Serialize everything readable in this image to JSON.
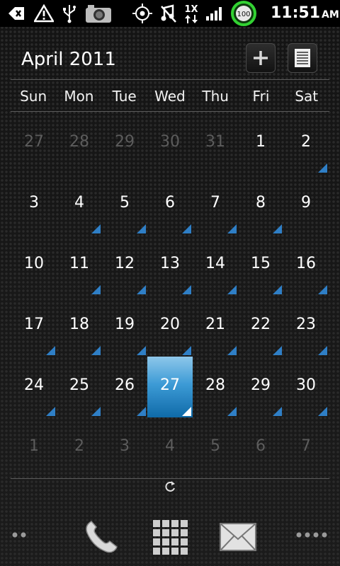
{
  "status_bar": {
    "time": "11:51",
    "ampm": "AM",
    "battery_level": "100",
    "network_label": "1X",
    "icons": [
      "back-icon",
      "alert-icon",
      "usb-icon",
      "camera-icon",
      "gps-icon",
      "mute-icon",
      "data-transfer-icon",
      "signal-icon",
      "battery-icon"
    ]
  },
  "calendar": {
    "title": "April 2011",
    "weekdays": [
      "Sun",
      "Mon",
      "Tue",
      "Wed",
      "Thu",
      "Fri",
      "Sat"
    ],
    "days": [
      {
        "label": "27",
        "current": false,
        "event": false
      },
      {
        "label": "28",
        "current": false,
        "event": false
      },
      {
        "label": "29",
        "current": false,
        "event": false
      },
      {
        "label": "30",
        "current": false,
        "event": false
      },
      {
        "label": "31",
        "current": false,
        "event": false
      },
      {
        "label": "1",
        "current": true,
        "event": false
      },
      {
        "label": "2",
        "current": true,
        "event": true
      },
      {
        "label": "3",
        "current": true,
        "event": false
      },
      {
        "label": "4",
        "current": true,
        "event": true
      },
      {
        "label": "5",
        "current": true,
        "event": true
      },
      {
        "label": "6",
        "current": true,
        "event": true
      },
      {
        "label": "7",
        "current": true,
        "event": true
      },
      {
        "label": "8",
        "current": true,
        "event": true
      },
      {
        "label": "9",
        "current": true,
        "event": false
      },
      {
        "label": "10",
        "current": true,
        "event": false
      },
      {
        "label": "11",
        "current": true,
        "event": true
      },
      {
        "label": "12",
        "current": true,
        "event": true
      },
      {
        "label": "13",
        "current": true,
        "event": true
      },
      {
        "label": "14",
        "current": true,
        "event": true
      },
      {
        "label": "15",
        "current": true,
        "event": true
      },
      {
        "label": "16",
        "current": true,
        "event": true
      },
      {
        "label": "17",
        "current": true,
        "event": true
      },
      {
        "label": "18",
        "current": true,
        "event": true
      },
      {
        "label": "19",
        "current": true,
        "event": true
      },
      {
        "label": "20",
        "current": true,
        "event": true
      },
      {
        "label": "21",
        "current": true,
        "event": true
      },
      {
        "label": "22",
        "current": true,
        "event": true
      },
      {
        "label": "23",
        "current": true,
        "event": true
      },
      {
        "label": "24",
        "current": true,
        "event": true
      },
      {
        "label": "25",
        "current": true,
        "event": true
      },
      {
        "label": "26",
        "current": true,
        "event": true
      },
      {
        "label": "27",
        "current": true,
        "event": true,
        "today": true
      },
      {
        "label": "28",
        "current": true,
        "event": true
      },
      {
        "label": "29",
        "current": true,
        "event": true
      },
      {
        "label": "30",
        "current": true,
        "event": true
      },
      {
        "label": "1",
        "current": false,
        "event": false
      },
      {
        "label": "2",
        "current": false,
        "event": false
      },
      {
        "label": "3",
        "current": false,
        "event": false
      },
      {
        "label": "4",
        "current": false,
        "event": false
      },
      {
        "label": "5",
        "current": false,
        "event": false
      },
      {
        "label": "6",
        "current": false,
        "event": false
      },
      {
        "label": "7",
        "current": false,
        "event": false
      }
    ],
    "accent_color": "#2f7fc6"
  },
  "dock": {
    "items": [
      "left-dots-icon",
      "phone-icon",
      "app-drawer-icon",
      "mail-icon",
      "right-dots-icon"
    ]
  }
}
